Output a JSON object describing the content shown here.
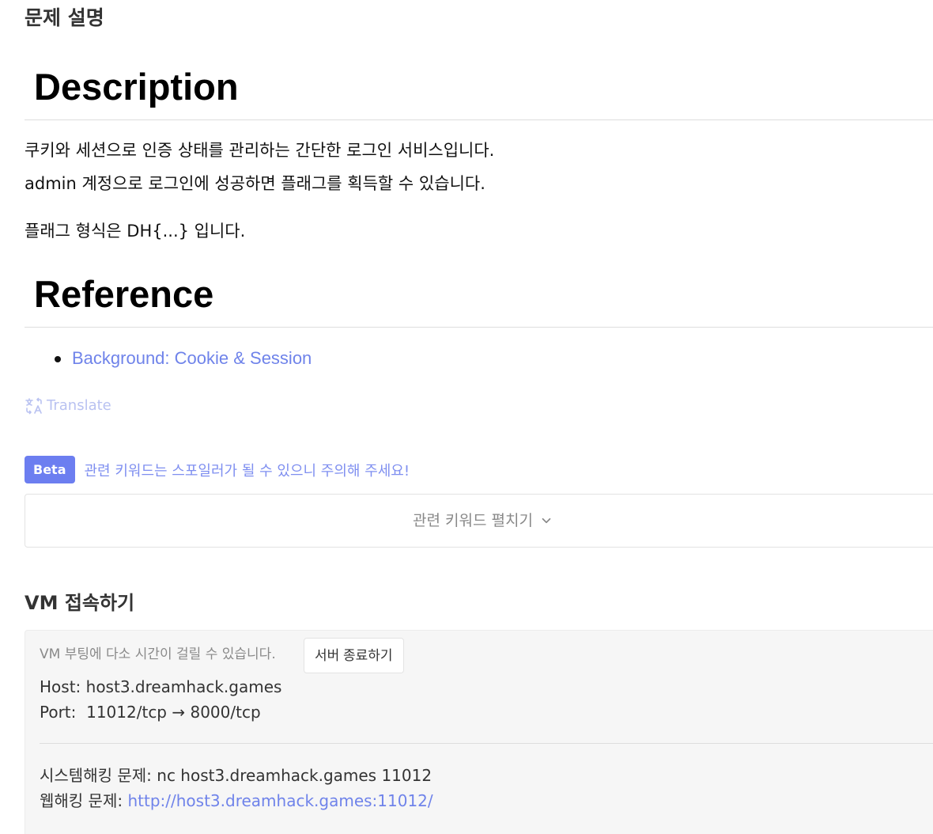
{
  "section_title": "문제 설명",
  "description": {
    "heading": "Description",
    "line1": "쿠키와 세션으로 인증 상태를 관리하는 간단한 로그인 서비스입니다.",
    "line2": "admin 계정으로 로그인에 성공하면 플래그를 획득할 수 있습니다.",
    "line3": "플래그 형식은 DH{...} 입니다."
  },
  "reference": {
    "heading": "Reference",
    "items": [
      {
        "label": "Background: Cookie & Session"
      }
    ]
  },
  "translate": {
    "label": "Translate",
    "icon": "translate-icon"
  },
  "keywords": {
    "badge": "Beta",
    "warning": "관련 키워드는 스포일러가 될 수 있으니 주의해 주세요!",
    "toggle_label": "관련 키워드 펼치기",
    "toggle_icon": "chevron-down-icon"
  },
  "vm": {
    "title": "VM 접속하기",
    "boot_note": "VM 부팅에 다소 시간이 걸릴 수 있습니다.",
    "stop_button": "서버 종료하기",
    "host_label": "Host:",
    "host_value": "host3.dreamhack.games",
    "port_label": "Port:",
    "port_value": "11012/tcp → 8000/tcp",
    "sys_label": "시스템해킹 문제:",
    "sys_value": "nc host3.dreamhack.games 11012",
    "web_label": "웹해킹 문제:",
    "web_value": "http://host3.dreamhack.games:11012/"
  },
  "colors": {
    "accent": "#6c7ef0",
    "link": "#6f83ea",
    "translate": "#b9c2f1"
  }
}
